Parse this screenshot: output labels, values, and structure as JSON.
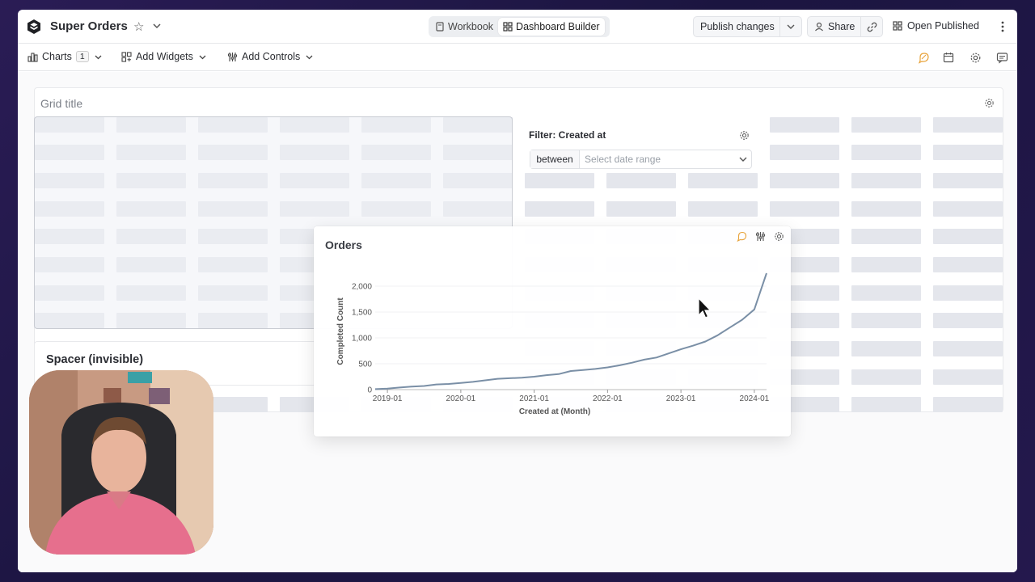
{
  "app": {
    "title": "Super Orders"
  },
  "header": {
    "tabs": [
      {
        "label": "Workbook",
        "active": false
      },
      {
        "label": "Dashboard Builder",
        "active": true
      }
    ],
    "publish_label": "Publish changes",
    "share_label": "Share",
    "open_published_label": "Open Published"
  },
  "toolbar": {
    "charts_label": "Charts",
    "charts_count": "1",
    "add_widgets_label": "Add Widgets",
    "add_controls_label": "Add Controls"
  },
  "grid": {
    "title": "Grid title"
  },
  "filter": {
    "title": "Filter: Created at",
    "operator": "between",
    "range_placeholder": "Select date range"
  },
  "spacer": {
    "title": "Spacer (invisible)"
  },
  "colors": {
    "accent_orange": "#e8a33a",
    "line": "#7a8fa6",
    "placeholder": "#e4e6ec"
  },
  "chart_data": {
    "type": "line",
    "title": "Orders",
    "xlabel": "Created at (Month)",
    "ylabel": "Completed Count",
    "ylim": [
      0,
      2250
    ],
    "yticks": [
      0,
      500,
      1000,
      1500,
      2000
    ],
    "ytick_labels": [
      "0",
      "500",
      "1,000",
      "1,500",
      "2,000"
    ],
    "xtick_labels": [
      "2019-01",
      "2020-01",
      "2021-01",
      "2022-01",
      "2023-01",
      "2024-01"
    ],
    "x_start": "2018-11",
    "x": [
      "2018-11",
      "2019-01",
      "2019-03",
      "2019-05",
      "2019-07",
      "2019-09",
      "2019-11",
      "2020-01",
      "2020-03",
      "2020-05",
      "2020-07",
      "2020-09",
      "2020-11",
      "2021-01",
      "2021-03",
      "2021-05",
      "2021-07",
      "2021-09",
      "2021-11",
      "2022-01",
      "2022-03",
      "2022-05",
      "2022-07",
      "2022-09",
      "2022-11",
      "2023-01",
      "2023-03",
      "2023-05",
      "2023-07",
      "2023-09",
      "2023-11",
      "2024-01",
      "2024-02",
      "2024-03"
    ],
    "series": [
      {
        "values": [
          10,
          20,
          40,
          60,
          70,
          100,
          110,
          130,
          150,
          180,
          210,
          220,
          230,
          250,
          280,
          300,
          360,
          380,
          400,
          430,
          470,
          520,
          580,
          620,
          700,
          780,
          850,
          930,
          1050,
          1200,
          1350,
          1550,
          1900,
          2250
        ]
      }
    ]
  }
}
